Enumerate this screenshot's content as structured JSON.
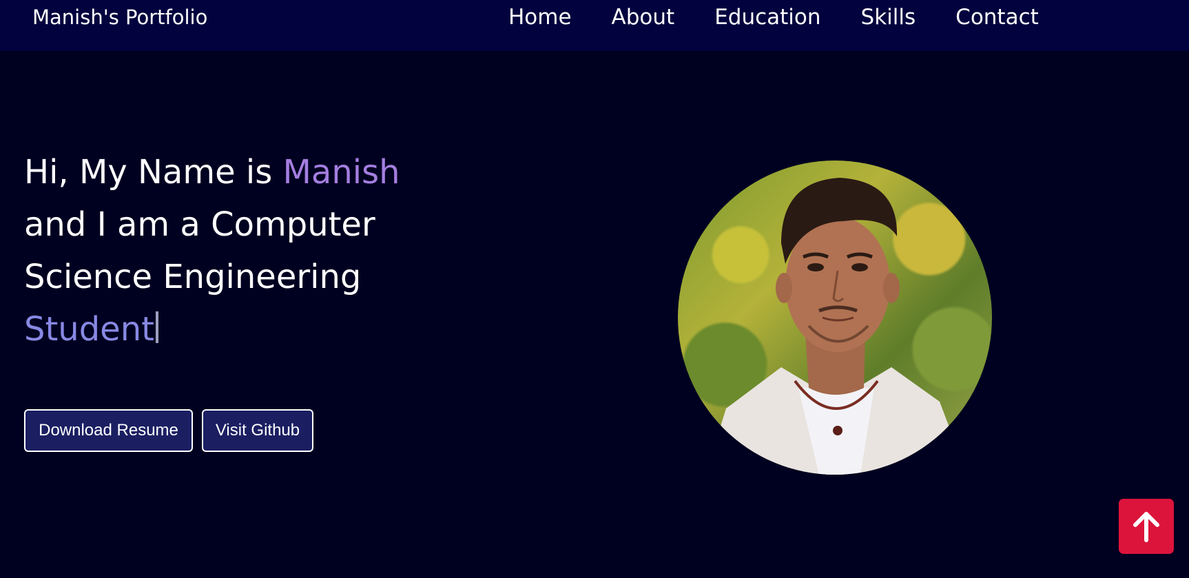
{
  "navbar": {
    "brand": "Manish's Portfolio",
    "links": [
      "Home",
      "About",
      "Education",
      "Skills",
      "Contact"
    ]
  },
  "hero": {
    "line1_prefix": "Hi, My Name is ",
    "name": "Manish",
    "line2": "and I am a Computer",
    "line3": "Science Engineering",
    "role": "Student"
  },
  "buttons": {
    "resume": "Download Resume",
    "github": "Visit Github"
  },
  "icons": {
    "scroll_top": "arrow-up-icon"
  },
  "colors": {
    "background": "#000020",
    "navbar": "#02023e",
    "name_accent": "#a47ee0",
    "role_accent": "#8888e4",
    "button_bg": "#1b1f62",
    "scroll_top_bg": "#dc143c"
  }
}
